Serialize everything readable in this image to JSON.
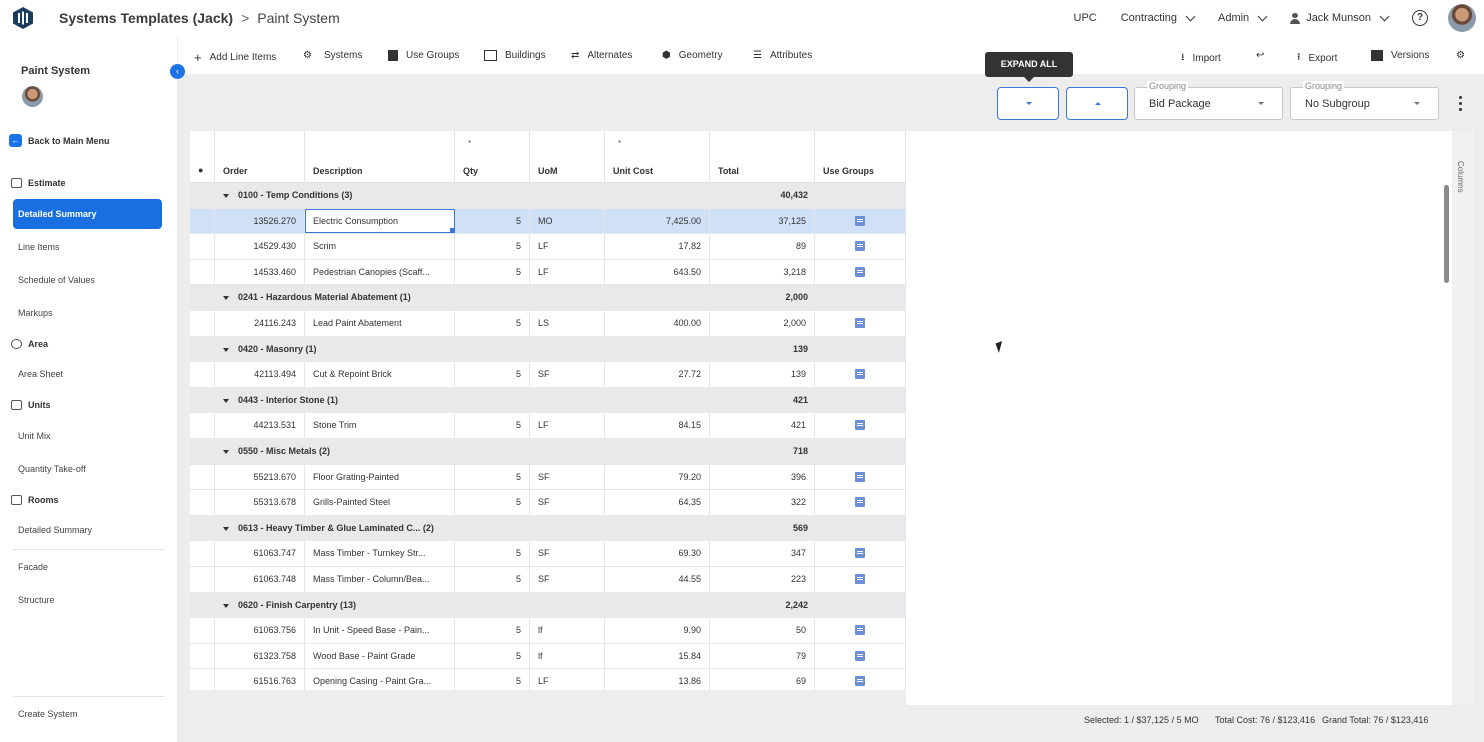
{
  "header": {
    "breadcrumb_root": "Systems Templates (Jack)",
    "breadcrumb_sep": ">",
    "breadcrumb_current": "Paint System",
    "company": "UPC",
    "menu_contracting": "Contracting",
    "menu_admin": "Admin",
    "user_name": "Jack Munson",
    "help": "?"
  },
  "sidebar": {
    "title": "Paint System",
    "back": "Back to Main Menu",
    "sections": {
      "estimate": "Estimate",
      "area": "Area",
      "units": "Units",
      "rooms": "Rooms"
    },
    "items": {
      "detailed_summary": "Detailed Summary",
      "line_items": "Line Items",
      "schedule_of_values": "Schedule of Values",
      "markups": "Markups",
      "area_sheet": "Area Sheet",
      "unit_mix": "Unit Mix",
      "quantity_takeoff": "Quantity Take-off",
      "rooms_detailed_summary": "Detailed Summary",
      "facade": "Facade",
      "structure": "Structure",
      "create_system": "Create System"
    }
  },
  "toolbar": {
    "add_line_items": "Add Line Items",
    "systems": "Systems",
    "use_groups": "Use Groups",
    "buildings": "Buildings",
    "alternates": "Alternates",
    "geometry": "Geometry",
    "attributes": "Attributes",
    "import": "Import",
    "export": "Export",
    "versions": "Versions",
    "tooltip": "EXPAND ALL"
  },
  "controls": {
    "grouping_label": "Grouping",
    "grouping_value": "Bid Package",
    "subgrouping_label": "Grouping",
    "subgrouping_value": "No Subgroup",
    "columns_label": "Columns"
  },
  "grid": {
    "headers": {
      "order": "Order",
      "description": "Description",
      "qty": "Qty",
      "uom": "UoM",
      "unit_cost": "Unit Cost",
      "total": "Total",
      "use_groups": "Use Groups",
      "required_mark": "*"
    },
    "groups": [
      {
        "title": "0100 - Temp Conditions (3)",
        "total": "40,432",
        "rows": [
          {
            "order": "13526.270",
            "desc": "Electric Consumption",
            "qty": "5",
            "uom": "MO",
            "unit_cost": "7,425.00",
            "total": "37,125"
          },
          {
            "order": "14529.430",
            "desc": "Scrim",
            "qty": "5",
            "uom": "LF",
            "unit_cost": "17.82",
            "total": "89"
          },
          {
            "order": "14533.460",
            "desc": "Pedestrian Canopies (Scaff...",
            "qty": "5",
            "uom": "LF",
            "unit_cost": "643.50",
            "total": "3,218"
          }
        ]
      },
      {
        "title": "0241 - Hazardous Material Abatement (1)",
        "total": "2,000",
        "rows": [
          {
            "order": "24116.243",
            "desc": "Lead Paint Abatement",
            "qty": "5",
            "uom": "LS",
            "unit_cost": "400.00",
            "total": "2,000"
          }
        ]
      },
      {
        "title": "0420 - Masonry (1)",
        "total": "139",
        "rows": [
          {
            "order": "42113.494",
            "desc": "Cut & Repoint Brick",
            "qty": "5",
            "uom": "SF",
            "unit_cost": "27.72",
            "total": "139"
          }
        ]
      },
      {
        "title": "0443 - Interior Stone (1)",
        "total": "421",
        "rows": [
          {
            "order": "44213.531",
            "desc": "Stone Trim",
            "qty": "5",
            "uom": "LF",
            "unit_cost": "84.15",
            "total": "421"
          }
        ]
      },
      {
        "title": "0550 - Misc Metals (2)",
        "total": "718",
        "rows": [
          {
            "order": "55213.670",
            "desc": "Floor Grating-Painted",
            "qty": "5",
            "uom": "SF",
            "unit_cost": "79.20",
            "total": "396"
          },
          {
            "order": "55313.678",
            "desc": "Grills-Painted Steel",
            "qty": "5",
            "uom": "SF",
            "unit_cost": "64.35",
            "total": "322"
          }
        ]
      },
      {
        "title": "0613 - Heavy Timber & Glue Laminated C... (2)",
        "total": "569",
        "rows": [
          {
            "order": "61063.747",
            "desc": "Mass Timber - Turnkey Str...",
            "qty": "5",
            "uom": "SF",
            "unit_cost": "69.30",
            "total": "347"
          },
          {
            "order": "61063.748",
            "desc": "Mass Timber - Column/Bea...",
            "qty": "5",
            "uom": "SF",
            "unit_cost": "44.55",
            "total": "223"
          }
        ]
      },
      {
        "title": "0620 - Finish Carpentry (13)",
        "total": "2,242",
        "rows": [
          {
            "order": "61063.756",
            "desc": "In Unit - Speed Base - Pain...",
            "qty": "5",
            "uom": "lf",
            "unit_cost": "9.90",
            "total": "50"
          },
          {
            "order": "61323.758",
            "desc": "Wood Base - Paint Grade",
            "qty": "5",
            "uom": "lf",
            "unit_cost": "15.84",
            "total": "79"
          },
          {
            "order": "61516.763",
            "desc": "Opening Casing - Paint Gra...",
            "qty": "5",
            "uom": "LF",
            "unit_cost": "13.86",
            "total": "69"
          }
        ]
      }
    ]
  },
  "status": {
    "selected": "Selected: 1 / $37,125 / 5 MO",
    "total_cost": "Total Cost: 76 / $123,416",
    "grand_total": "Grand Total: 76 / $123,416"
  },
  "colors": {
    "accent": "#1a6fe0",
    "selected_row": "#cfe0f7",
    "group_row": "#e9e9ec"
  }
}
